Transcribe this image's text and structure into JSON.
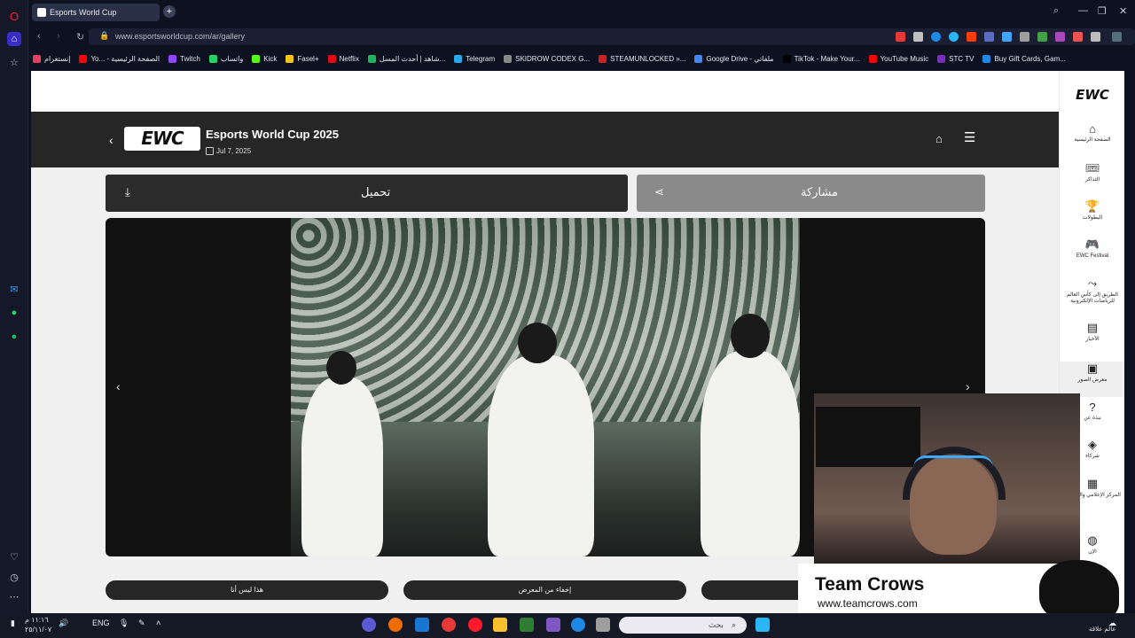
{
  "browser": {
    "tab_title": "Esports World Cup",
    "url": "www.esportsworldcup.com/ar/gallery",
    "bookmarks": [
      "إنستغرام",
      "Yo... - الصفحة الرئيسية",
      "Twitch",
      "واتساب",
      "Kick",
      "Fasel+",
      "Netflix",
      "شاهد | أحدث المسل...",
      "Telegram",
      "SKIDROW CODEX G...",
      "STEAMUNLOCKED »...",
      "Google Drive - ملفاتي",
      "TikTok - Make Your...",
      "YouTube Music",
      "STC TV",
      "Buy Gift Cards, Gam..."
    ],
    "bookmark_colors": [
      "#e4405f",
      "#ff0000",
      "#9146ff",
      "#25d366",
      "#53fc18",
      "#f5c518",
      "#e50914",
      "#1fb25a",
      "#29a9eb",
      "#888888",
      "#cc2222",
      "#4285f4",
      "#000000",
      "#ff0000",
      "#7b2cbf",
      "#1e88e5"
    ]
  },
  "page": {
    "title": "Esports World Cup 2025",
    "date": "Jul 7, 2025",
    "logo_text": "EWC",
    "download_label": "تحميل",
    "share_label": "مشاركة",
    "pills": [
      "هذا ليس أنا",
      "إخفاء من المعرض"
    ]
  },
  "sidebar": {
    "logo_text": "EWC",
    "items": [
      {
        "label": "الصفحة الرئيسية",
        "icon": "home-icon",
        "glyph": "⌂"
      },
      {
        "label": "التذاكر",
        "icon": "ticket-icon",
        "glyph": "🎟"
      },
      {
        "label": "البطولات",
        "icon": "trophy-icon",
        "glyph": "🏆"
      },
      {
        "label": "EWC Festival",
        "icon": "gamepad-icon",
        "glyph": "🎮"
      },
      {
        "label": "الطريق إلى كأس العالم للرياضات الإلكترونية",
        "icon": "route-icon",
        "glyph": "⤳"
      },
      {
        "label": "الأخبار",
        "icon": "news-icon",
        "glyph": "▤"
      },
      {
        "label": "معرض الصور",
        "icon": "gallery-icon",
        "glyph": "▣"
      },
      {
        "label": "نبذة عن",
        "icon": "help-icon",
        "glyph": "?"
      },
      {
        "label": "شركاء",
        "icon": "partners-icon",
        "glyph": "◈"
      },
      {
        "label": "المركز الإعلامي والصحفي",
        "icon": "media-center-icon",
        "glyph": "▦"
      },
      {
        "label": "الإن",
        "icon": "globe-icon",
        "glyph": "◍"
      }
    ]
  },
  "overlay": {
    "brand_title": "Team Crows",
    "brand_url": "www.teamcrows.com"
  },
  "taskbar": {
    "time": "١١:١٦ م",
    "date": "٢٥/١١/٠٧",
    "lang": "ENG",
    "search_placeholder": "بحث",
    "corner_text": "عالم علاقة"
  }
}
